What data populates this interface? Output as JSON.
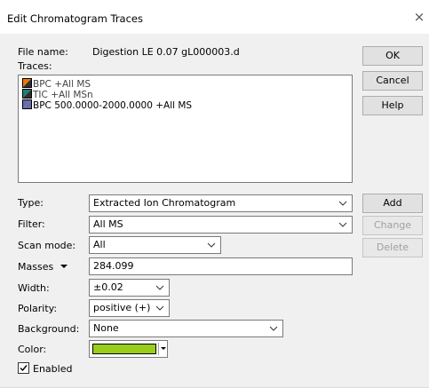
{
  "window": {
    "title": "Edit Chromatogram Traces",
    "close_glyph": "×"
  },
  "file": {
    "label": "File name:",
    "value": "Digestion LE 0.07 gL000003.d"
  },
  "traces": {
    "label": "Traces:",
    "items": [
      {
        "label": "BPC +All MS",
        "swatch": [
          "#f07800",
          "#303030"
        ],
        "text_color": "#444444"
      },
      {
        "label": "TIC +All MSn",
        "swatch": [
          "#208070",
          "#303030"
        ],
        "text_color": "#444444"
      },
      {
        "label": "BPC 500.0000-2000.0000 +All MS",
        "swatch": [
          "#6a6aa8",
          "#6a6aa8"
        ],
        "text_color": "#000000"
      }
    ]
  },
  "buttons": {
    "ok": "OK",
    "cancel": "Cancel",
    "help": "Help",
    "add": "Add",
    "change": "Change",
    "delete": "Delete"
  },
  "form": {
    "type": {
      "label": "Type:",
      "value": "Extracted Ion Chromatogram"
    },
    "filter": {
      "label": "Filter:",
      "value": "All MS"
    },
    "scan_mode": {
      "label": "Scan mode:",
      "value": "All"
    },
    "masses": {
      "label": "Masses",
      "value": "284.099"
    },
    "width": {
      "label": "Width:",
      "value": "±0.02"
    },
    "polarity": {
      "label": "Polarity:",
      "value": "positive (+)"
    },
    "background": {
      "label": "Background:",
      "value": "None"
    },
    "color": {
      "label": "Color:",
      "value": "#9acd1a"
    },
    "enabled": {
      "label": "Enabled",
      "checked": true
    }
  }
}
